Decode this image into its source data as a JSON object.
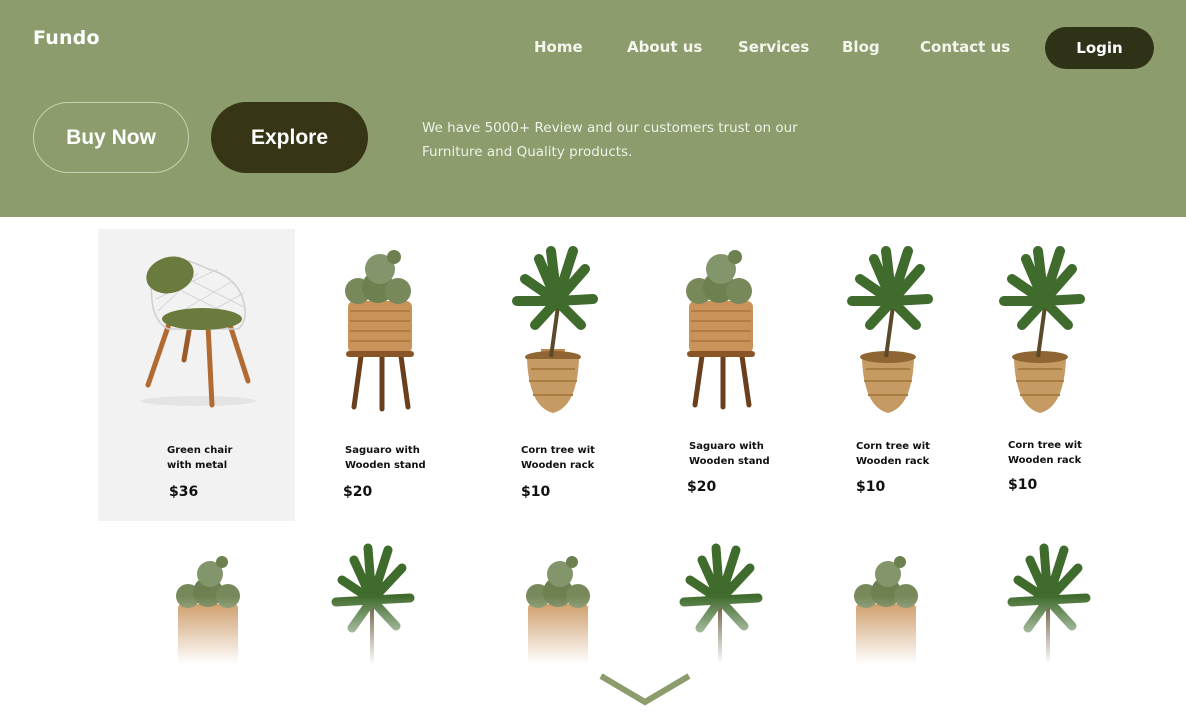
{
  "brand": "Fundo",
  "nav": {
    "items": [
      "Home",
      "About us",
      "Services",
      "Blog",
      "Contact us"
    ],
    "login_label": "Login"
  },
  "hero": {
    "buy_label": "Buy Now",
    "explore_label": "Explore",
    "tagline_line1": "We have 5000+ Review and our customers trust on our",
    "tagline_line2": "Furniture and Quality products."
  },
  "products": [
    {
      "name1": "Green chair",
      "name2": "with metal",
      "price": "$36",
      "icon": "chair-icon"
    },
    {
      "name1": "Saguaro with",
      "name2": "Wooden stand",
      "price": "$20",
      "icon": "cactus-icon"
    },
    {
      "name1": "Corn tree wit",
      "name2": "Wooden rack",
      "price": "$10",
      "icon": "corn-tree-icon"
    },
    {
      "name1": "Saguaro with",
      "name2": "Wooden stand",
      "price": "$20",
      "icon": "cactus-icon"
    },
    {
      "name1": "Corn tree wit",
      "name2": "Wooden rack",
      "price": "$10",
      "icon": "corn-tree-icon"
    },
    {
      "name1": "Corn tree wit",
      "name2": "Wooden rack",
      "price": "$10",
      "icon": "corn-tree-icon"
    }
  ],
  "colors": {
    "hero_bg": "#8c9c6c",
    "dark_button": "#363515",
    "card_highlight": "#f2f2f2",
    "chevron": "#8c9c6c"
  },
  "icons": {
    "scroll_down": "chevron-down-icon"
  }
}
